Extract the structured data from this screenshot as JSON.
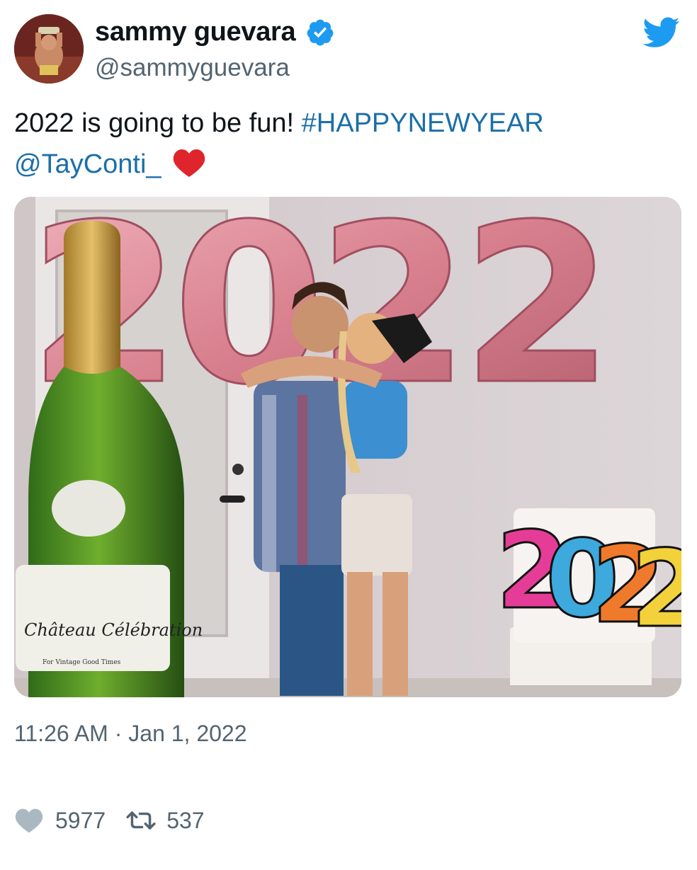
{
  "author": {
    "display_name": "sammy guevara",
    "handle": "@sammyguevara",
    "verified": true,
    "avatar_icon": "avatar-photo"
  },
  "tweet": {
    "text_plain": "2022 is going to be fun! ",
    "hashtag": "#HAPPYNEWYEAR",
    "mention": "@TayConti_",
    "emoji": "❤️",
    "link_color": "#1b6fa8"
  },
  "media": {
    "balloon_text": "2022",
    "sign_text": "2022",
    "bottle_label": "Château Célébration",
    "bottle_sublabel": "For Vintage Good Times"
  },
  "meta": {
    "timestamp": "11:26 AM · Jan 1, 2022"
  },
  "engagement": {
    "likes": "5977",
    "retweets": "537"
  },
  "colors": {
    "brand": "#1d9bf0",
    "text_secondary": "#536471"
  }
}
